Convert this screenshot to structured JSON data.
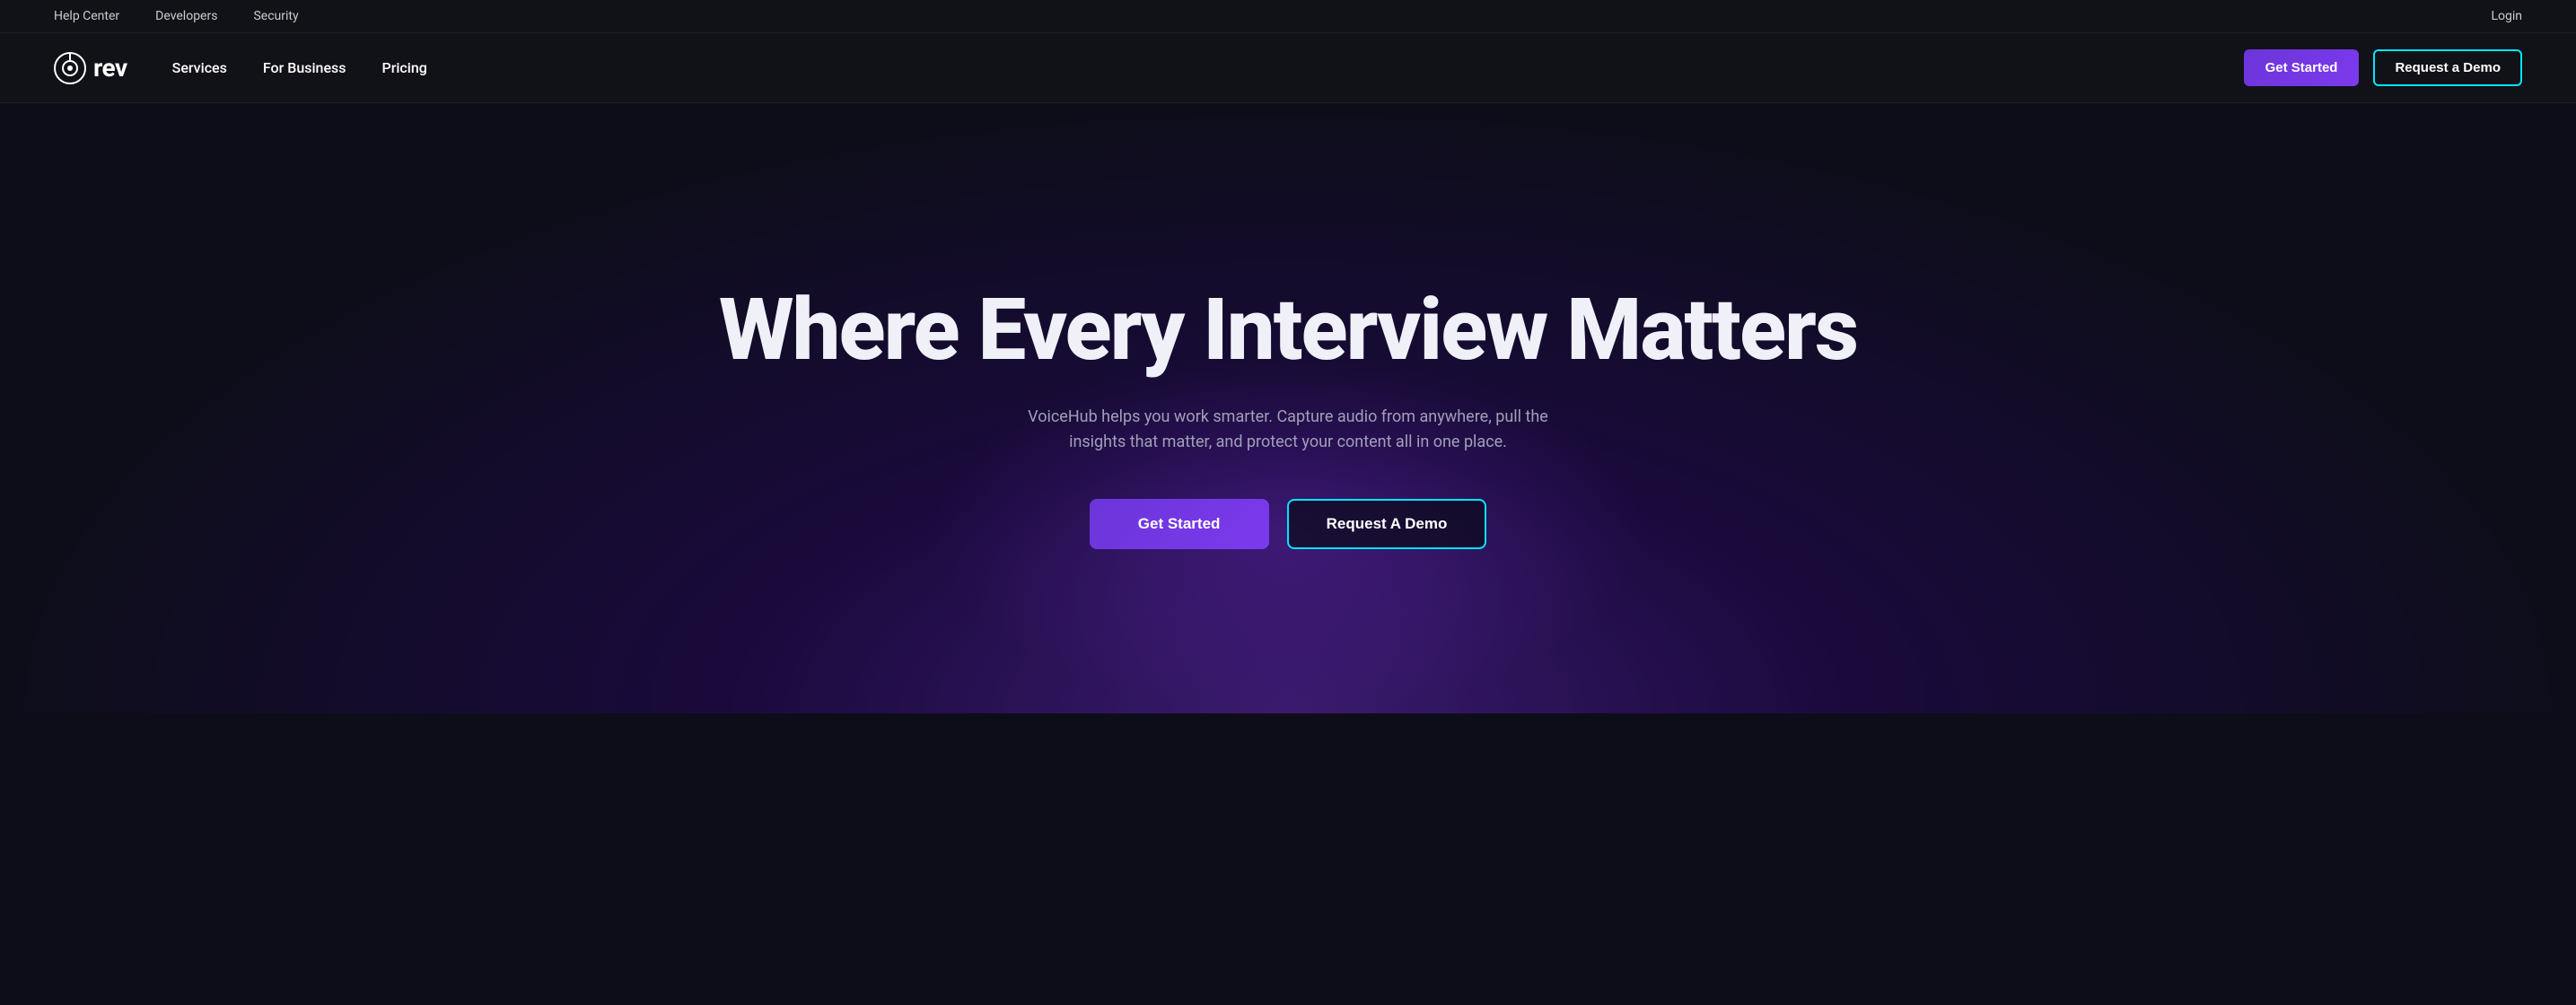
{
  "utility_bar": {
    "links": [
      {
        "id": "help-center",
        "label": "Help Center"
      },
      {
        "id": "developers",
        "label": "Developers"
      },
      {
        "id": "security",
        "label": "Security"
      }
    ],
    "login_label": "Login"
  },
  "main_nav": {
    "logo": {
      "text": "rev"
    },
    "nav_links": [
      {
        "id": "services",
        "label": "Services"
      },
      {
        "id": "for-business",
        "label": "For Business"
      },
      {
        "id": "pricing",
        "label": "Pricing"
      }
    ],
    "get_started_label": "Get Started",
    "request_demo_label": "Request a Demo"
  },
  "hero": {
    "title": "Where Every Interview Matters",
    "subtitle": "VoiceHub helps you work smarter. Capture audio from anywhere, pull the insights that matter, and protect your content all in one place.",
    "get_started_label": "Get Started",
    "request_demo_label": "Request A Demo"
  }
}
